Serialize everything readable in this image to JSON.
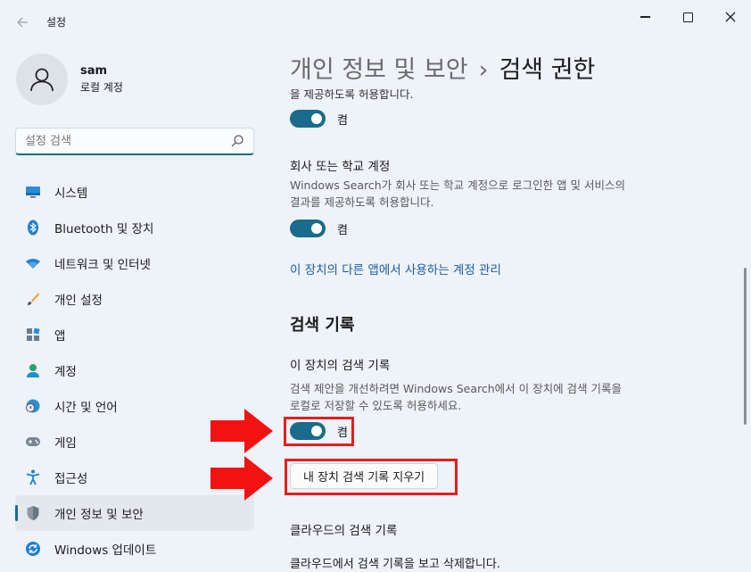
{
  "window": {
    "title": "설정",
    "back_icon": "arrow-left-icon",
    "minimize_icon": "minimize-icon",
    "maximize_icon": "maximize-icon",
    "close_icon": "close-icon"
  },
  "profile": {
    "name": "sam",
    "account_type": "로컬 계정"
  },
  "search": {
    "placeholder": "설정 검색",
    "icon": "search-icon"
  },
  "sidebar": {
    "items": [
      {
        "label": "시스템",
        "icon": "system-icon"
      },
      {
        "label": "Bluetooth 및 장치",
        "icon": "bluetooth-icon"
      },
      {
        "label": "네트워크 및 인터넷",
        "icon": "wifi-icon"
      },
      {
        "label": "개인 설정",
        "icon": "brush-icon"
      },
      {
        "label": "앱",
        "icon": "apps-icon"
      },
      {
        "label": "계정",
        "icon": "account-icon"
      },
      {
        "label": "시간 및 언어",
        "icon": "globe-clock-icon"
      },
      {
        "label": "게임",
        "icon": "gamepad-icon"
      },
      {
        "label": "접근성",
        "icon": "accessibility-icon"
      },
      {
        "label": "개인 정보 및 보안",
        "icon": "shield-icon",
        "active": true
      },
      {
        "label": "Windows 업데이트",
        "icon": "update-icon"
      }
    ]
  },
  "header": {
    "parent": "개인 정보 및 보안",
    "separator": "›",
    "current": "검색 권한"
  },
  "content": {
    "clipped_text": "을 제공하도록 허용합니다.",
    "toggle1": {
      "state_label": "켬",
      "on": true
    },
    "work_account": {
      "title": "회사 또는 학교 계정",
      "description_line1": "Windows Search가 회사 또는 학교 계정으로 로그인한 앱 및 서비스의",
      "description_line2": "결과를 제공하도록 허용합니다.",
      "toggle": {
        "state_label": "켬",
        "on": true
      }
    },
    "manage_link": "이 장치의 다른 앱에서 사용하는 계정 관리",
    "search_history": {
      "section_title": "검색 기록",
      "device_title": "이 장치의 검색 기록",
      "description_line1": "검색 제안을 개선하려면 Windows Search에서 이 장치에 검색 기록을",
      "description_line2": "로컬로 저장할 수 있도록 허용하세요.",
      "toggle": {
        "state_label": "켬",
        "on": true
      },
      "clear_button": "내 장치 검색 기록 지우기"
    },
    "cloud": {
      "title": "클라우드의 검색 기록",
      "description": "클라우드에서 검색 기록을 보고 삭제합니다."
    }
  },
  "colors": {
    "accent": "#1a6b8c",
    "highlight": "#e81d1d",
    "link": "#1a5fa0"
  }
}
